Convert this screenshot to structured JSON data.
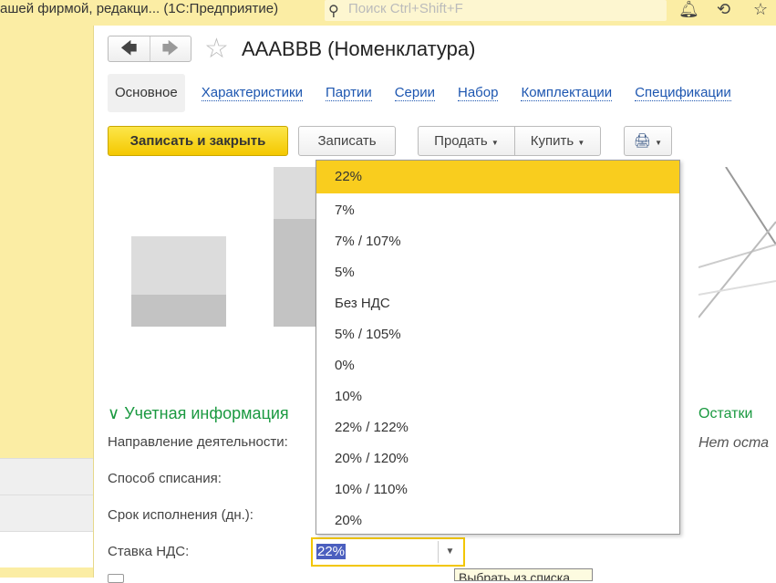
{
  "window": {
    "title": "ашей фирмой, редакци...   (1С:Предприятие)",
    "search_placeholder": "Поиск Ctrl+Shift+F"
  },
  "header": {
    "title": "АААВВВ (Номенклатура)"
  },
  "tabs": [
    "Основное",
    "Характеристики",
    "Партии",
    "Серии",
    "Набор",
    "Комплектации",
    "Спецификации"
  ],
  "toolbar": {
    "save_close": "Записать и закрыть",
    "save": "Записать",
    "sell": "Продать",
    "buy": "Купить"
  },
  "vat_options": [
    "22%",
    "7%",
    "7% / 107%",
    "5%",
    "Без НДС",
    "5% / 105%",
    "0%",
    "10%",
    "22% / 122%",
    "20% / 120%",
    "10% / 110%",
    "20%"
  ],
  "section": {
    "title": "Учетная информация",
    "fields": [
      "Направление деятельности:",
      "Способ списания:",
      "Срок исполнения (дн.):",
      "Ставка НДС:"
    ]
  },
  "vat_value": "22%",
  "stock": {
    "title": "Остатки",
    "empty": "Нет оста"
  },
  "tooltip": "Выбрать из списка"
}
